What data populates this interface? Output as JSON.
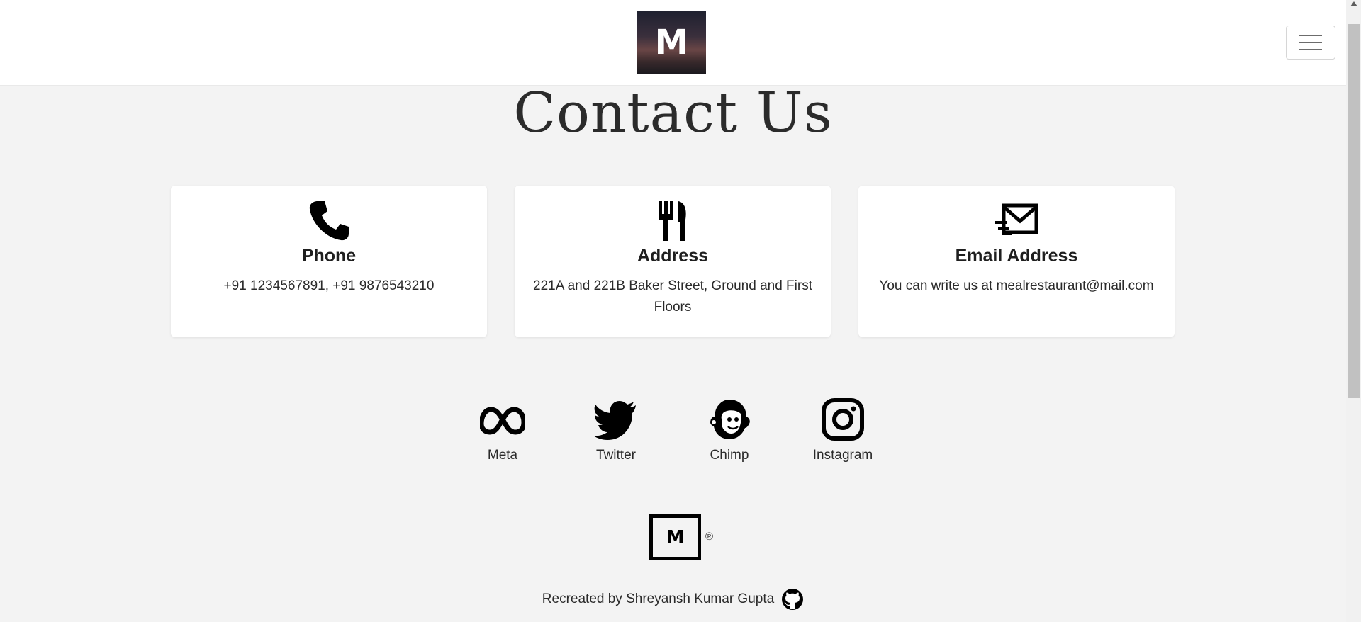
{
  "header": {
    "logo_letter": "M",
    "menu_toggle": "menu-toggle"
  },
  "main": {
    "title": "Contact Us",
    "cards": [
      {
        "icon": "phone-icon",
        "title": "Phone",
        "text": "+91 1234567891, +91 9876543210"
      },
      {
        "icon": "fork-knife-icon",
        "title": "Address",
        "text": "221A and 221B Baker Street, Ground and First Floors"
      },
      {
        "icon": "mail-fast-icon",
        "title": "Email Address",
        "text": "You can write us at mealrestaurant@mail.com"
      }
    ],
    "socials": [
      {
        "icon": "meta-icon",
        "label": "Meta"
      },
      {
        "icon": "twitter-icon",
        "label": "Twitter"
      },
      {
        "icon": "mailchimp-icon",
        "label": "Chimp"
      },
      {
        "icon": "instagram-icon",
        "label": "Instagram"
      }
    ]
  },
  "footer": {
    "logo_letter": "M",
    "registered": "®",
    "credit": "Recreated by Shreyansh Kumar Gupta",
    "credit_icon": "github-icon"
  },
  "colors": {
    "page_background": "#f3f3f3",
    "card_background": "#ffffff",
    "text": "#212529"
  }
}
